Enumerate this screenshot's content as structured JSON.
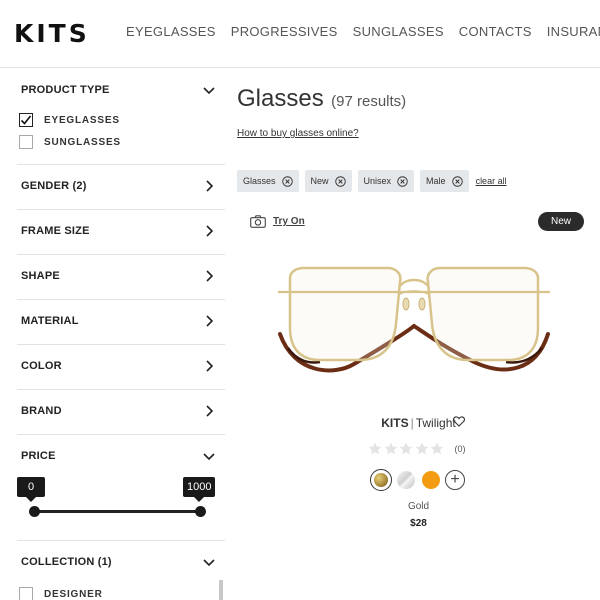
{
  "header": {
    "logo": "KITS",
    "nav": [
      "EYEGLASSES",
      "PROGRESSIVES",
      "SUNGLASSES",
      "CONTACTS",
      "INSURANCE"
    ]
  },
  "sidebar": {
    "product_type": {
      "label": "PRODUCT TYPE",
      "options": [
        {
          "label": "EYEGLASSES",
          "checked": true
        },
        {
          "label": "SUNGLASSES",
          "checked": false
        }
      ]
    },
    "filters": [
      "GENDER (2)",
      "FRAME SIZE",
      "SHAPE",
      "MATERIAL",
      "COLOR",
      "BRAND"
    ],
    "price": {
      "label": "PRICE",
      "min": "0",
      "max": "1000"
    },
    "collection": {
      "label": "COLLECTION (1)",
      "options": [
        {
          "label": "DESIGNER",
          "checked": false
        }
      ]
    }
  },
  "main": {
    "title": "Glasses",
    "results": "(97 results)",
    "how_to_link": "How to buy glasses online?",
    "chips": [
      "Glasses",
      "New",
      "Unisex",
      "Male"
    ],
    "clear_all": "clear all",
    "try_on": "Try On",
    "badge": "New",
    "product": {
      "brand": "KITS",
      "separator": "|",
      "model": "Twilight",
      "review_count": "(0)",
      "stars": 0,
      "swatches": [
        {
          "name": "gold",
          "color": "#9a7b2f",
          "selected": true
        },
        {
          "name": "clear",
          "color": "#d9d9d9",
          "selected": false
        },
        {
          "name": "orange",
          "color": "#f39c12",
          "selected": false
        }
      ],
      "color_name": "Gold",
      "price": "$28"
    }
  },
  "colors": {
    "accent_dark": "#1a1a1a",
    "chip_bg": "#e4e8eb",
    "frame_gold": "#d8c38a",
    "temple_tortoise": "#6b2d14"
  }
}
